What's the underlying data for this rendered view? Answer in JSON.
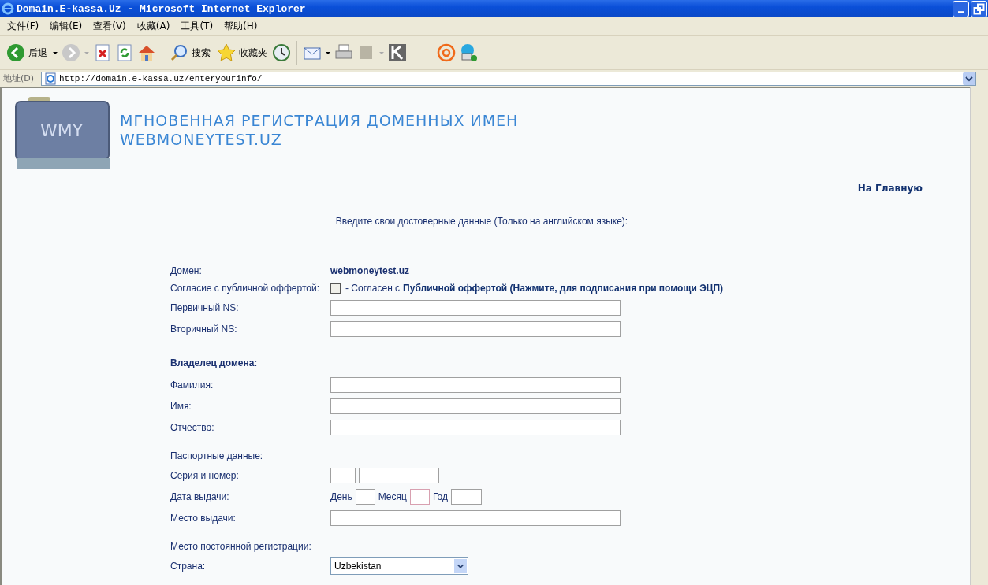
{
  "window": {
    "title": "Domain.E-kassa.Uz - Microsoft Internet Explorer"
  },
  "menu": [
    "文件(F)",
    "编辑(E)",
    "查看(V)",
    "收藏(A)",
    "工具(T)",
    "帮助(H)"
  ],
  "toolbar": {
    "back": "后退",
    "search": "搜索",
    "favorites": "收藏夹"
  },
  "address": {
    "label": "地址(D)",
    "value": "http://domain.e-kassa.uz/enteryourinfo/"
  },
  "page": {
    "logo": "WMY",
    "heading_1": "МГНОВЕННАЯ РЕГИСТРАЦИЯ ДОМЕННЫХ ИМЕН",
    "heading_2": "WEBMONEYTEST.UZ",
    "home_link": "На Главную",
    "intro": "Введите свои достоверные данные (Только на английском языке):"
  },
  "form": [
    {
      "kind": "value",
      "label": "Домен:",
      "value": "webmoneytest.uz"
    },
    {
      "kind": "checkbox",
      "label": "Согласие с публичной оффертой:",
      "checked": false,
      "text": "- Согласен с",
      "link": "Публичной оффертой (Нажмите, для подписания при помощи ЭЦП)"
    },
    {
      "kind": "text",
      "label": "Первичный NS:"
    },
    {
      "kind": "text",
      "label": "Вторичный NS:"
    },
    {
      "kind": "heading",
      "label": "Владелец домена:"
    },
    {
      "kind": "text",
      "label": "Фамилия:"
    },
    {
      "kind": "text",
      "label": "Имя:"
    },
    {
      "kind": "text",
      "label": "Отчество:"
    },
    {
      "kind": "section",
      "label": "Паспортные данные:"
    },
    {
      "kind": "passport",
      "label": "Серия и номер:"
    },
    {
      "kind": "date",
      "label": "Дата выдачи:",
      "day": "День",
      "month": "Месяц",
      "year": "Год"
    },
    {
      "kind": "text",
      "label": "Место выдачи:"
    },
    {
      "kind": "section",
      "label": "Место постоянной регистрации:"
    },
    {
      "kind": "select",
      "label": "Страна:",
      "value": "Uzbekistan"
    }
  ]
}
